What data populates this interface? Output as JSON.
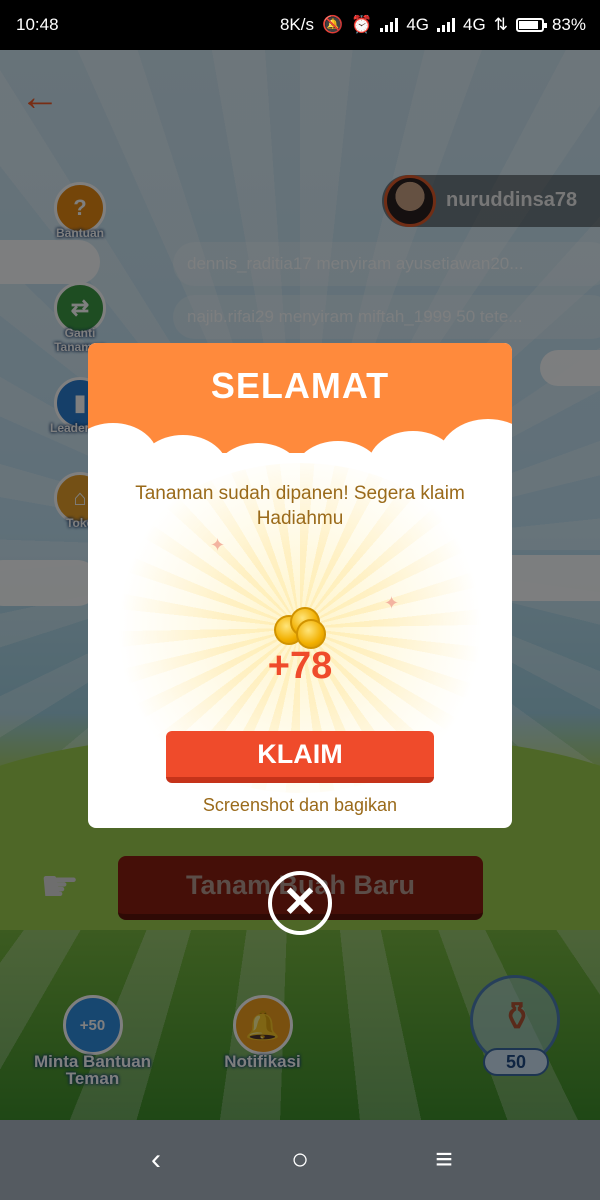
{
  "status_bar": {
    "time": "10:48",
    "net_speed": "8K/s",
    "network_1": "4G",
    "network_2": "4G",
    "battery": "83%"
  },
  "game": {
    "user": {
      "name": "nuruddinsa78"
    },
    "feed": [
      "dennis_raditia17 menyiram ayusetiawan20...",
      "najib.rifai29 menyiram miftah_1999 50 tete..."
    ],
    "side_menu": {
      "help": "Bantuan",
      "change_plant": "Ganti Tanaman",
      "leaderboard": "Leaderboard",
      "shop": "Toko"
    },
    "plant_button": "Tanam Buah Baru",
    "bottom": {
      "ask_help_badge": "+50",
      "ask_help": "Minta Bantuan Teman",
      "notifications": "Notifikasi",
      "water_count": "50"
    }
  },
  "modal": {
    "title": "SELAMAT",
    "message": "Tanaman sudah dipanen! Segera klaim Hadiahmu",
    "reward": "+78",
    "claim_button": "KLAIM",
    "share_link": "Screenshot dan bagikan"
  },
  "colors": {
    "accent_orange": "#ff8a3c",
    "claim_red": "#ef4b2b",
    "message_brown": "#9a6a1a"
  }
}
